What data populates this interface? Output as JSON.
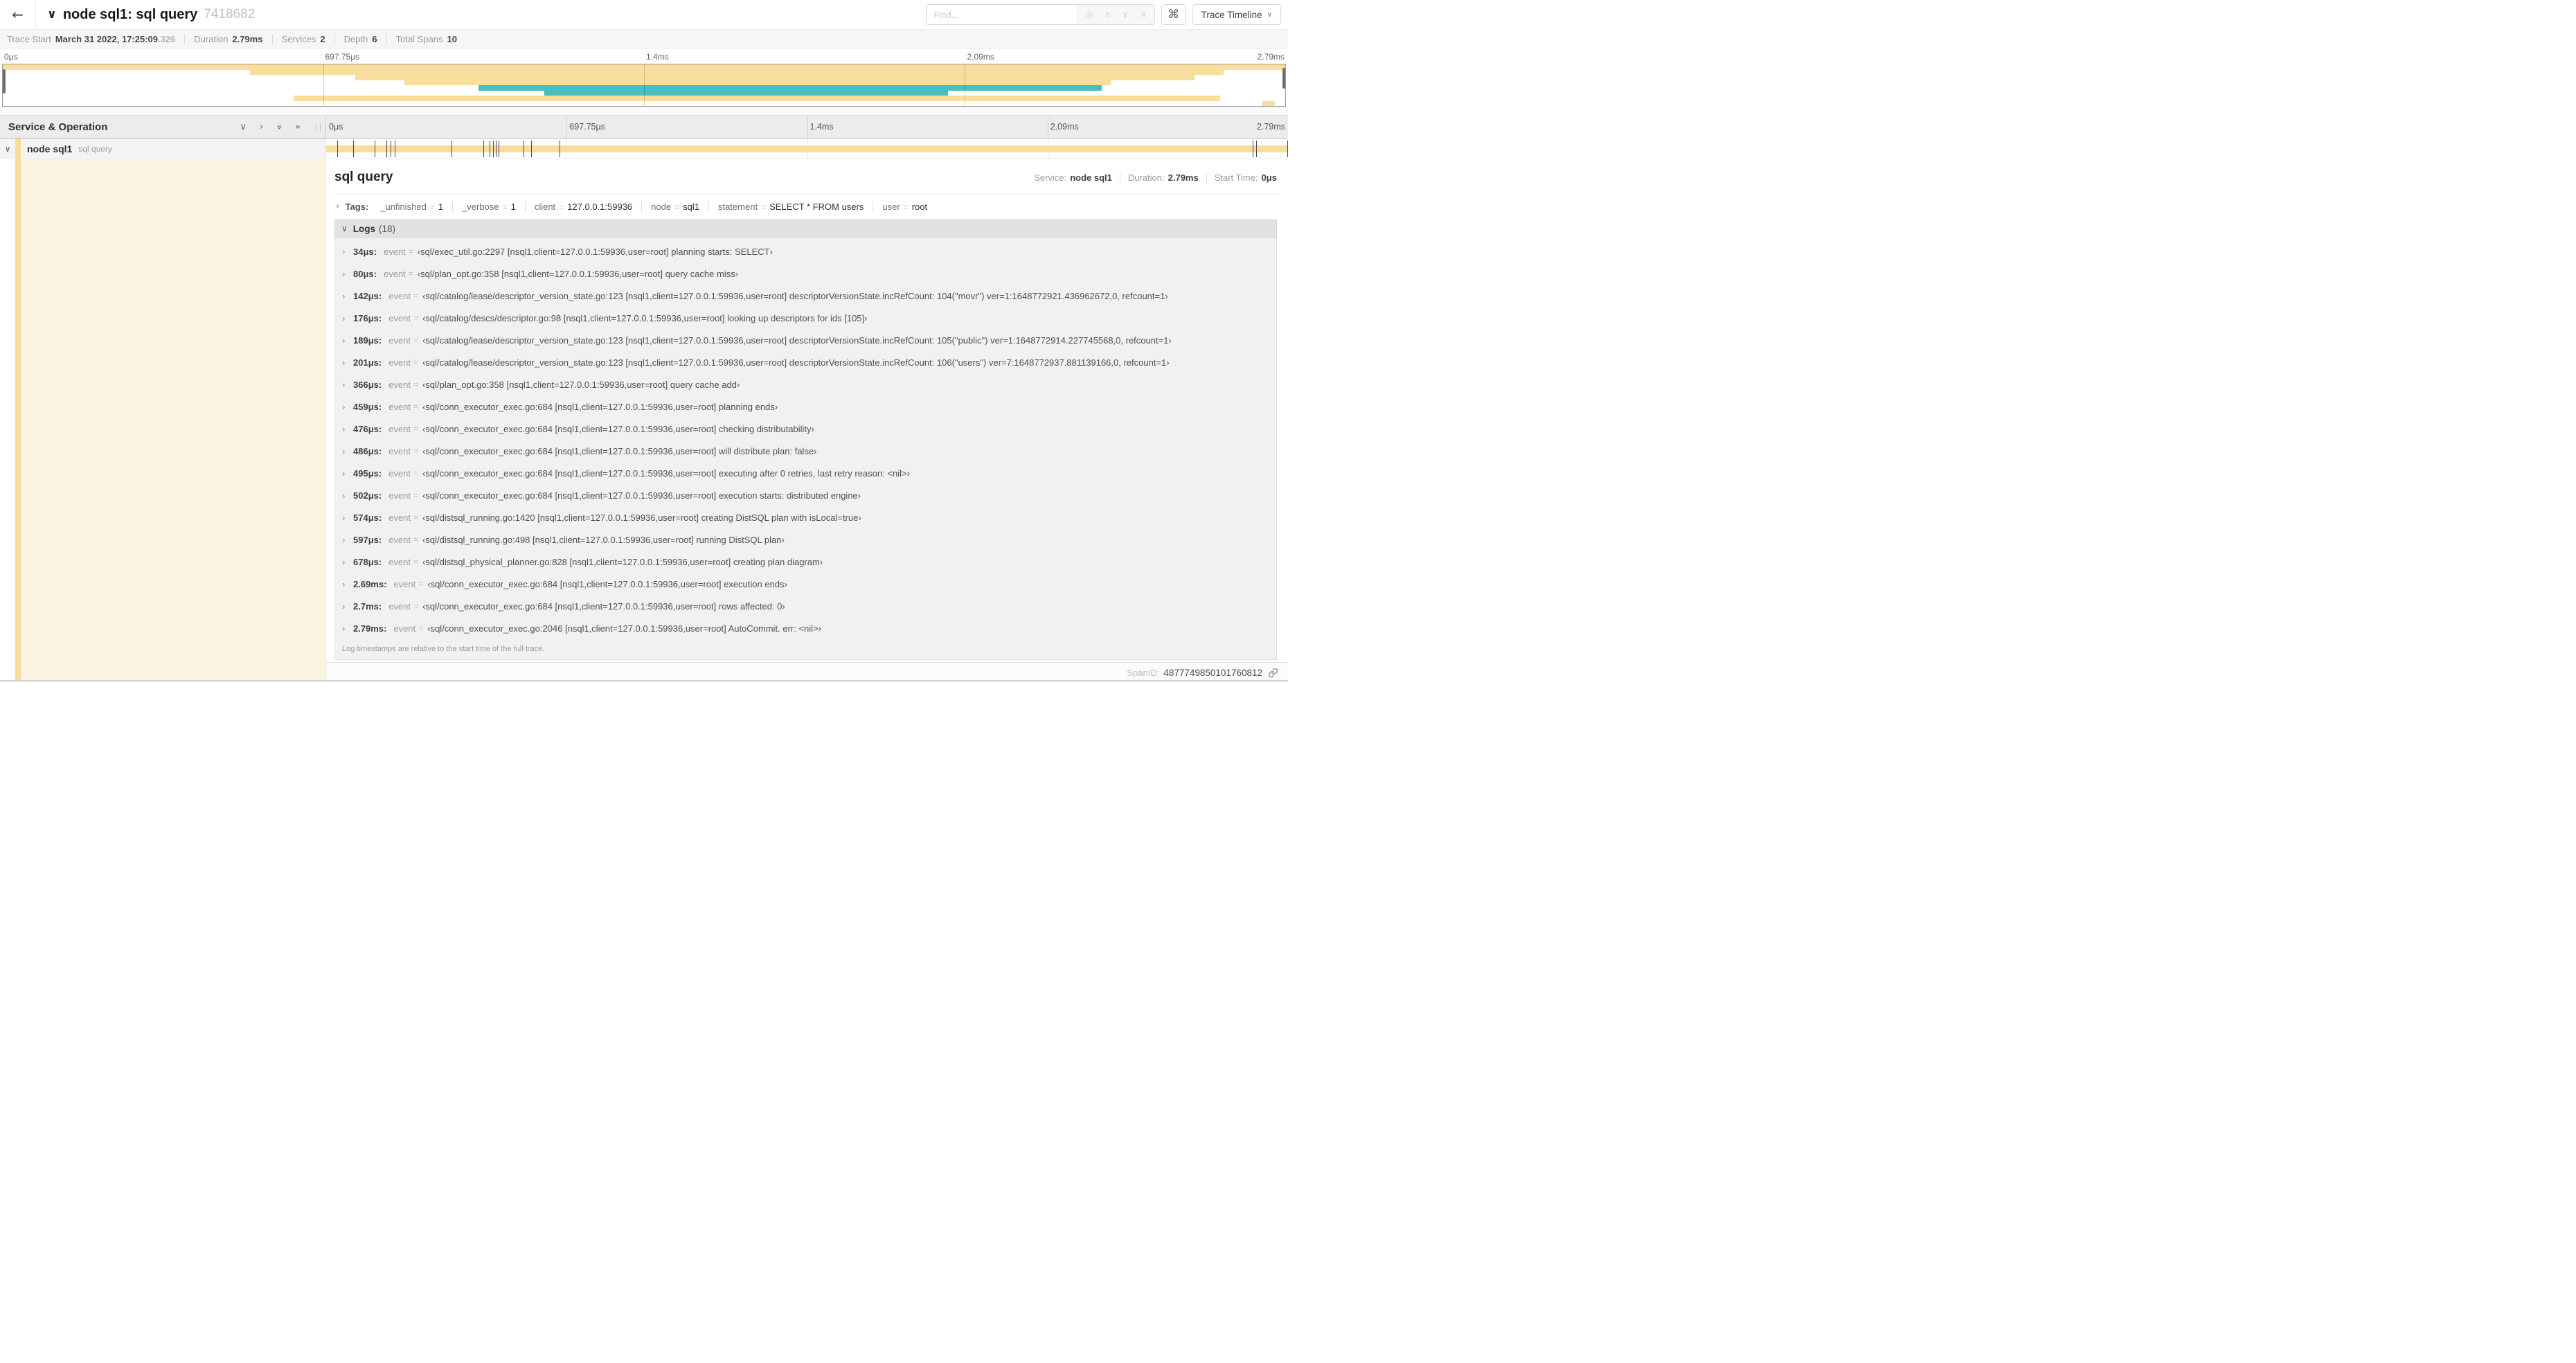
{
  "header": {
    "title": "node sql1: sql query",
    "trace_id": "7418682",
    "find_placeholder": "Find...",
    "keyboard_shortcut_icon": "⌘",
    "view_selector": "Trace Timeline"
  },
  "icons": {
    "back": "←",
    "title_collapse": "∨",
    "locate": "◎",
    "prev_match": "∧",
    "next_match": "∨",
    "clear": "×",
    "dropdown": "∨",
    "collapse_one": "∨",
    "expand_one": "›",
    "collapse_all": "»",
    "expand_all": "»",
    "row_collapse": "∨",
    "row_expand": "›",
    "logs_collapse": "∨"
  },
  "trace_info": {
    "items": [
      {
        "label": "Trace Start",
        "value": "March 31 2022, 17:25:09",
        "suffix": ".326"
      },
      {
        "label": "Duration",
        "value": "2.79ms",
        "suffix": ""
      },
      {
        "label": "Services",
        "value": "2",
        "suffix": ""
      },
      {
        "label": "Depth",
        "value": "6",
        "suffix": ""
      },
      {
        "label": "Total Spans",
        "value": "10",
        "suffix": ""
      }
    ]
  },
  "time_ticks": [
    "0μs",
    "697.75μs",
    "1.4ms",
    "2.09ms",
    "2.79ms"
  ],
  "minimap": {
    "spans": [
      {
        "row": 0,
        "start": 0,
        "end": 100,
        "color": "tan"
      },
      {
        "row": 1,
        "start": 19.3,
        "end": 95.2,
        "color": "tan"
      },
      {
        "row": 2,
        "start": 27.5,
        "end": 92.9,
        "color": "tan"
      },
      {
        "row": 3,
        "start": 31.3,
        "end": 86.4,
        "color": "tan"
      },
      {
        "row": 4,
        "start": 37.1,
        "end": 85.7,
        "color": "teal"
      },
      {
        "row": 5,
        "start": 42.2,
        "end": 73.7,
        "color": "teal"
      },
      {
        "row": 6,
        "start": 22.7,
        "end": 94.9,
        "color": "tan"
      },
      {
        "row": 7,
        "start": 98.2,
        "end": 99.2,
        "color": "tan"
      }
    ]
  },
  "timeline": {
    "column_header": "Service & Operation",
    "row": {
      "service": "node sql1",
      "operation": "sql query",
      "bar": {
        "start": 0,
        "end": 100,
        "color": "tan"
      },
      "tick_positions": [
        1.22,
        2.87,
        5.09,
        6.31,
        6.77,
        7.2,
        13.12,
        16.45,
        17.06,
        17.42,
        17.74,
        17.99,
        20.57,
        21.4,
        24.3,
        96.42,
        96.77,
        100
      ]
    }
  },
  "detail": {
    "title": "sql query",
    "service_label": "Service:",
    "service_value": "node sql1",
    "duration_label": "Duration:",
    "duration_value": "2.79ms",
    "start_label": "Start Time:",
    "start_value": "0μs",
    "tags": {
      "label": "Tags:",
      "items": [
        {
          "key": "_unfinished",
          "value": "1"
        },
        {
          "key": "_verbose",
          "value": "1"
        },
        {
          "key": "client",
          "value": "127.0.0.1:59936"
        },
        {
          "key": "node",
          "value": "sql1"
        },
        {
          "key": "statement",
          "value": "SELECT * FROM users"
        },
        {
          "key": "user",
          "value": "root"
        }
      ]
    },
    "logs": {
      "label": "Logs",
      "count": "(18)",
      "field": "event",
      "entries": [
        {
          "time": "34μs:",
          "value": "‹sql/exec_util.go:2297 [nsql1,client=127.0.0.1:59936,user=root] planning starts: SELECT›"
        },
        {
          "time": "80μs:",
          "value": "‹sql/plan_opt.go:358 [nsql1,client=127.0.0.1:59936,user=root] query cache miss›"
        },
        {
          "time": "142μs:",
          "value": "‹sql/catalog/lease/descriptor_version_state.go:123 [nsql1,client=127.0.0.1:59936,user=root] descriptorVersionState.incRefCount: 104(\"movr\") ver=1:1648772921.436962672,0, refcount=1›"
        },
        {
          "time": "176μs:",
          "value": "‹sql/catalog/descs/descriptor.go:98 [nsql1,client=127.0.0.1:59936,user=root] looking up descriptors for ids [105]›"
        },
        {
          "time": "189μs:",
          "value": "‹sql/catalog/lease/descriptor_version_state.go:123 [nsql1,client=127.0.0.1:59936,user=root] descriptorVersionState.incRefCount: 105(\"public\") ver=1:1648772914.227745568,0, refcount=1›"
        },
        {
          "time": "201μs:",
          "value": "‹sql/catalog/lease/descriptor_version_state.go:123 [nsql1,client=127.0.0.1:59936,user=root] descriptorVersionState.incRefCount: 106(\"users\") ver=7:1648772937.881139166,0, refcount=1›"
        },
        {
          "time": "366μs:",
          "value": "‹sql/plan_opt.go:358 [nsql1,client=127.0.0.1:59936,user=root] query cache add›"
        },
        {
          "time": "459μs:",
          "value": "‹sql/conn_executor_exec.go:684 [nsql1,client=127.0.0.1:59936,user=root] planning ends›"
        },
        {
          "time": "476μs:",
          "value": "‹sql/conn_executor_exec.go:684 [nsql1,client=127.0.0.1:59936,user=root] checking distributability›"
        },
        {
          "time": "486μs:",
          "value": "‹sql/conn_executor_exec.go:684 [nsql1,client=127.0.0.1:59936,user=root] will distribute plan: false›"
        },
        {
          "time": "495μs:",
          "value": "‹sql/conn_executor_exec.go:684 [nsql1,client=127.0.0.1:59936,user=root] executing after 0 retries, last retry reason: <nil>›"
        },
        {
          "time": "502μs:",
          "value": "‹sql/conn_executor_exec.go:684 [nsql1,client=127.0.0.1:59936,user=root] execution starts: distributed engine›"
        },
        {
          "time": "574μs:",
          "value": "‹sql/distsql_running.go:1420 [nsql1,client=127.0.0.1:59936,user=root] creating DistSQL plan with isLocal=true›"
        },
        {
          "time": "597μs:",
          "value": "‹sql/distsql_running.go:498 [nsql1,client=127.0.0.1:59936,user=root] running DistSQL plan›"
        },
        {
          "time": "678μs:",
          "value": "‹sql/distsql_physical_planner.go:828 [nsql1,client=127.0.0.1:59936,user=root] creating plan diagram›"
        },
        {
          "time": "2.69ms:",
          "value": "‹sql/conn_executor_exec.go:684 [nsql1,client=127.0.0.1:59936,user=root] execution ends›"
        },
        {
          "time": "2.7ms:",
          "value": "‹sql/conn_executor_exec.go:684 [nsql1,client=127.0.0.1:59936,user=root] rows affected: 0›"
        },
        {
          "time": "2.79ms:",
          "value": "‹sql/conn_executor_exec.go:2046 [nsql1,client=127.0.0.1:59936,user=root] AutoCommit. err: <nil>›"
        }
      ],
      "note": "Log timestamps are relative to the start time of the full trace."
    },
    "span_id_label": "SpanID:",
    "span_id": "4877749850101760812"
  },
  "colors": {
    "span_tan": "#F8DE9C",
    "span_teal": "#48BEBE"
  }
}
